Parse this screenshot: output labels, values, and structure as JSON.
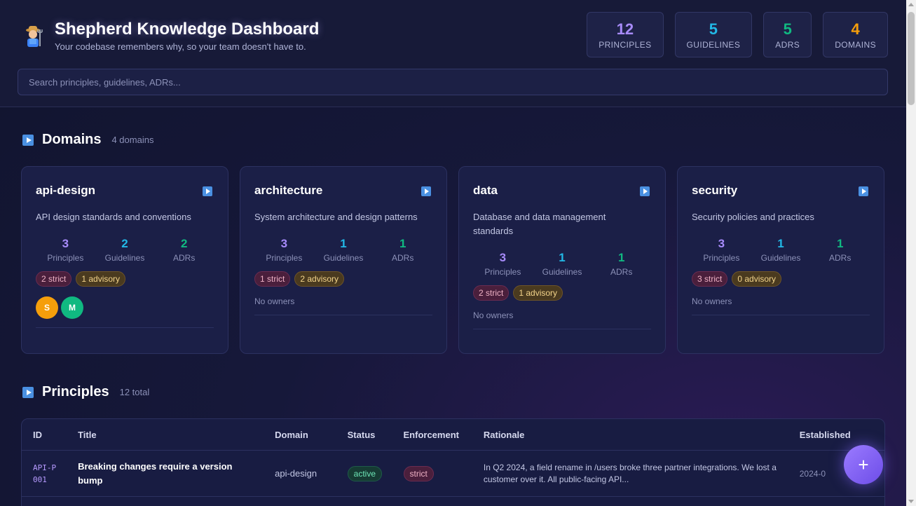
{
  "header": {
    "title": "Shepherd Knowledge Dashboard",
    "subtitle": "Your codebase remembers why, so your team doesn't have to.",
    "logo_icon": "farmer-emoji-icon",
    "stats": [
      {
        "value": "12",
        "label": "PRINCIPLES",
        "color": "#a78bfa"
      },
      {
        "value": "5",
        "label": "GUIDELINES",
        "color": "#22b8e6"
      },
      {
        "value": "5",
        "label": "ADRS",
        "color": "#10b981"
      },
      {
        "value": "4",
        "label": "DOMAINS",
        "color": "#f59e0b"
      }
    ]
  },
  "search": {
    "placeholder": "Search principles, guidelines, ADRs..."
  },
  "domains": {
    "title": "Domains",
    "count": "4 domains",
    "cards": [
      {
        "name": "api-design",
        "desc": "API design standards and conventions",
        "principles": "3",
        "guidelines": "2",
        "adrs": "2",
        "strict": "2 strict",
        "advisory": "1 advisory",
        "owners": [
          {
            "initial": "S",
            "color": "#f59e0b"
          },
          {
            "initial": "M",
            "color": "#10b981"
          }
        ]
      },
      {
        "name": "architecture",
        "desc": "System architecture and design patterns",
        "principles": "3",
        "guidelines": "1",
        "adrs": "1",
        "strict": "1 strict",
        "advisory": "2 advisory",
        "no_owners": "No owners"
      },
      {
        "name": "data",
        "desc": "Database and data management standards",
        "principles": "3",
        "guidelines": "1",
        "adrs": "1",
        "strict": "2 strict",
        "advisory": "1 advisory",
        "no_owners": "No owners"
      },
      {
        "name": "security",
        "desc": "Security policies and practices",
        "principles": "3",
        "guidelines": "1",
        "adrs": "1",
        "strict": "3 strict",
        "advisory": "0 advisory",
        "no_owners": "No owners"
      }
    ],
    "labels": {
      "principles": "Principles",
      "guidelines": "Guidelines",
      "adrs": "ADRs"
    },
    "colors": {
      "principles": "#a78bfa",
      "guidelines": "#22b8e6",
      "adrs": "#10b981"
    }
  },
  "principles": {
    "title": "Principles",
    "count": "12 total",
    "columns": [
      "ID",
      "Title",
      "Domain",
      "Status",
      "Enforcement",
      "Rationale",
      "Established"
    ],
    "rows": [
      {
        "id": "API-P001",
        "title": "Breaking changes require a version bump",
        "domain": "api-design",
        "status": "active",
        "enforcement": "strict",
        "rationale": "In Q2 2024, a field rename in /users broke three partner integrations. We lost a customer over it. All public-facing API...",
        "established": "2024-0"
      }
    ]
  },
  "fab": {
    "label": "+"
  }
}
